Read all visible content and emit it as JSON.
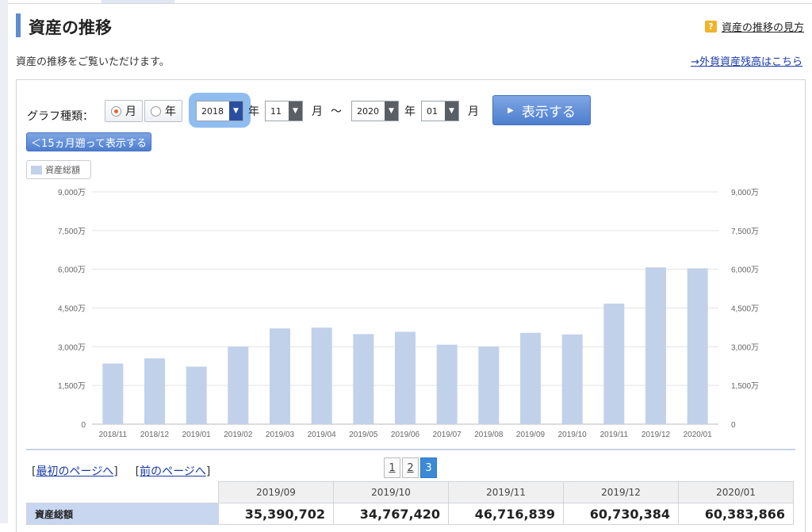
{
  "header": {
    "title": "資産の推移",
    "help_link": "資産の推移の見方",
    "subtitle": "資産の推移をご覧いただけます。",
    "fx_link": "→外貨資産残高はこちら"
  },
  "controls": {
    "graph_type_label": "グラフ種類：",
    "radio_month": "月",
    "radio_year": "年",
    "selected_type": "月",
    "from_year": "2018",
    "from_month": "11",
    "to_year": "2020",
    "to_month": "01",
    "year_unit": "年",
    "month_unit": "月",
    "range_sep": "〜",
    "show_button": "表示する",
    "back_button": "＜15ヵ月遡って表示する"
  },
  "legend": {
    "label": "資産総額",
    "color": "#c2d1ea"
  },
  "chart_data": {
    "type": "bar",
    "categories": [
      "2018/11",
      "2018/12",
      "2019/01",
      "2019/02",
      "2019/03",
      "2019/04",
      "2019/05",
      "2019/06",
      "2019/07",
      "2019/08",
      "2019/09",
      "2019/10",
      "2019/11",
      "2019/12",
      "2020/01"
    ],
    "series": [
      {
        "name": "資産総額",
        "values": [
          2350,
          2550,
          2230,
          3010,
          3710,
          3740,
          3490,
          3580,
          3080,
          3010,
          3539,
          3477,
          4672,
          6073,
          6038
        ]
      }
    ],
    "y_ticks": [
      "0",
      "1,500万",
      "3,000万",
      "4,500万",
      "6,000万",
      "7,500万",
      "9,000万"
    ],
    "ylim": [
      0,
      9000
    ],
    "y_unit": "万",
    "grid": true,
    "bar_color": "#c2d1ea"
  },
  "pager": {
    "first": "最初のページへ",
    "prev": "前のページへ",
    "pages": [
      "1",
      "2",
      "3"
    ],
    "current": "3"
  },
  "table": {
    "headers": [
      "2019/09",
      "2019/10",
      "2019/11",
      "2019/12",
      "2020/01"
    ],
    "row_label": "資産総額",
    "values": [
      "35,390,702",
      "34,767,420",
      "46,716,839",
      "60,730,384",
      "60,383,866"
    ]
  }
}
